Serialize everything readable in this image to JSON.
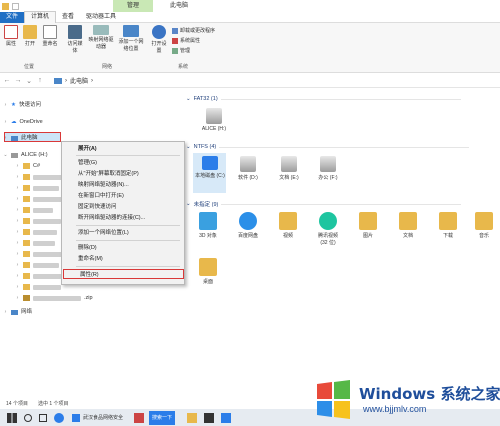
{
  "titlebar": {
    "manage_label": "管理",
    "title": "此电脑"
  },
  "ribbon_tabs": [
    "文件",
    "计算机",
    "查看",
    "驱动器工具"
  ],
  "ribbon": {
    "location": {
      "properties": "属性",
      "open": "打开",
      "rename": "重命名",
      "group": "位置"
    },
    "network": {
      "access_media": "访问媒体",
      "map_drive": "映射网络驱动器",
      "add_location": "添加一个网络位置",
      "group": "网络"
    },
    "system": {
      "open_settings": "打开设置",
      "uninstall": "卸载或更改程序",
      "system_properties": "系统属性",
      "manage": "管理",
      "group": "系统"
    }
  },
  "address": {
    "crumb": "此电脑",
    "separator": "›"
  },
  "nav": {
    "quick_access": "快速访问",
    "onedrive": "OneDrive",
    "this_pc": "此电脑",
    "alice_drive": "ALICE (H:)",
    "csharp": "C#",
    "network": "网络",
    "suffix_zip": ".zip"
  },
  "sections": {
    "fat32": "FAT32 (1)",
    "ntfs": "NTFS (4)",
    "unspecified": "未指定 (9)"
  },
  "drives": [
    {
      "label": "ALICE (H:)"
    },
    {
      "label": "本地磁盘 (C:)"
    },
    {
      "label": "软件 (D:)"
    },
    {
      "label": "文档 (E:)"
    },
    {
      "label": "办公 (F:)"
    }
  ],
  "folders": [
    {
      "label": "3D 对象",
      "color": "#3aa0e0"
    },
    {
      "label": "百度网盘",
      "color": "#2b8fe8"
    },
    {
      "label": "视频",
      "color": "#e8b84b"
    },
    {
      "label": "腾讯视频",
      "sub": "(32 位)",
      "color": "#1ec5a0"
    },
    {
      "label": "图片",
      "color": "#e8b84b"
    },
    {
      "label": "文档",
      "color": "#e8b84b"
    },
    {
      "label": "下载",
      "color": "#e8b84b"
    },
    {
      "label": "音乐",
      "color": "#e8b84b"
    },
    {
      "label": "桌面",
      "color": "#e8b84b"
    }
  ],
  "context_menu": {
    "expand": "展开(A)",
    "manage": "管理(G)",
    "unpin_start": "从\"开始\"屏幕取消固定(P)",
    "map_drive": "映射网络驱动器(N)...",
    "open_new_window": "在新窗口中打开(E)",
    "pin_quick": "固定到快速访问",
    "disconnect": "断开网络驱动器的连接(C)...",
    "add_location": "添加一个网络位置(L)",
    "delete": "删除(D)",
    "rename": "重命名(M)",
    "properties": "属性(R)"
  },
  "status": {
    "count": "14 个项目",
    "selected": "选中 1 个项目"
  },
  "taskbar": {
    "task1": "武汉食品网络安全",
    "search_btn": "搜索一下"
  },
  "watermark": {
    "brand": "Windows",
    "suffix": "系统之家",
    "url": "www.bjjmlv.com"
  },
  "colors": {
    "accent": "#1f6fc5",
    "selection": "#cce4f7",
    "highlight_border": "#d93838",
    "folder": "#e8b84b"
  }
}
